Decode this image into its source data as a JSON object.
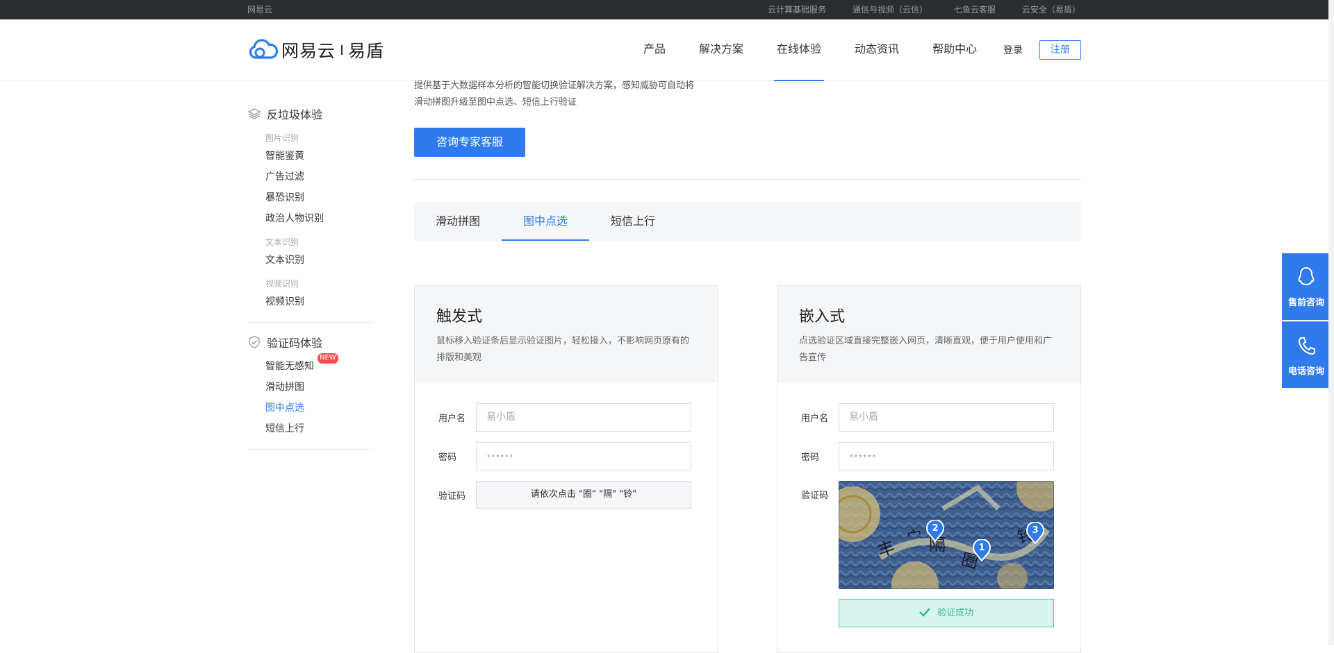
{
  "topbar": {
    "brand": "网易云",
    "links": [
      "云计算基础服务",
      "通信与视频（云信）",
      "七鱼云客服",
      "云安全（易盾）"
    ]
  },
  "header": {
    "logo_name": "网易云",
    "logo_sub": "易盾",
    "nav": [
      "产品",
      "解决方案",
      "在线体验",
      "动态资讯",
      "帮助中心"
    ],
    "active_nav": "在线体验",
    "login": "登录",
    "register": "注册"
  },
  "sidebar": {
    "section1": {
      "title": "反垃圾体验",
      "group1_header": "图片识别",
      "group1_items": [
        "智能鉴黄",
        "广告过滤",
        "暴恐识别",
        "政治人物识别"
      ],
      "group2_header": "文本识别",
      "group2_items": [
        "文本识别"
      ],
      "group3_header": "视频识别",
      "group3_items": [
        "视频识别"
      ]
    },
    "section2": {
      "title": "验证码体验",
      "items": [
        "智能无感知",
        "滑动拼图",
        "图中点选",
        "短信上行"
      ],
      "badge": "NEW",
      "active_item": "图中点选"
    }
  },
  "main": {
    "intro_line1": "提供基于大数据样本分析的智能切换验证解决方案，感知威胁可自动将",
    "intro_line2": "滑动拼图升级至图中点选、短信上行验证",
    "consult_button": "咨询专家客服",
    "tabs": [
      "滑动拼图",
      "图中点选",
      "短信上行"
    ],
    "active_tab": "图中点选"
  },
  "panels": {
    "left": {
      "title": "触发式",
      "desc": "鼠标移入验证条后显示验证图片，轻松接入，不影响网页原有的排版和美观",
      "username_label": "用户名",
      "username_placeholder": "易小盾",
      "password_label": "密码",
      "password_value": "••••••",
      "captcha_label": "验证码",
      "captcha_prompt": "请依次点击 \"圈\" \"隔\" \"铃\""
    },
    "right": {
      "title": "嵌入式",
      "desc": "点选验证区域直接完整嵌入网页，清晰直观，便于用户使用和广告宣传",
      "username_label": "用户名",
      "username_placeholder": "易小盾",
      "password_label": "密码",
      "password_value": "••••••",
      "captcha_label": "验证码",
      "markers": [
        "1",
        "2",
        "3"
      ],
      "success_text": "验证成功"
    }
  },
  "float": {
    "presale": "售前咨询",
    "phone": "电话咨询"
  },
  "colors": {
    "accent": "#2f7bed",
    "topbar": "#2b2d31",
    "success_bg": "#d7f5ee",
    "success_text": "#3ab795",
    "badge": "#ff4d4f"
  }
}
